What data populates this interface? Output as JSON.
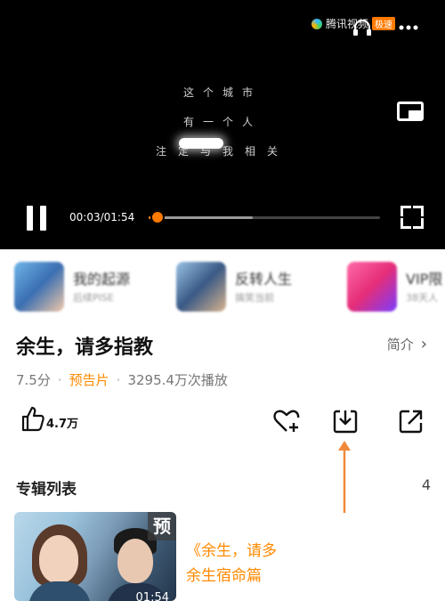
{
  "player": {
    "logo_text": "腾讯视频",
    "logo_tag": "极速",
    "lyrics": [
      "这个城市",
      "有一个人",
      "注定与我相关"
    ],
    "time": "00:03/01:54",
    "progress": 0.04,
    "buffered": 0.45,
    "accent_color": "#ff7a00",
    "icons": [
      "headphones-icon",
      "more-icon",
      "pip-icon",
      "pause-icon",
      "fullscreen-icon"
    ]
  },
  "recommendations": [
    {
      "title": "我的起源",
      "subtitle": "后续PISE"
    },
    {
      "title": "反转人生",
      "subtitle": "搞笑当前"
    },
    {
      "title": "VIP限",
      "subtitle": "38天人"
    }
  ],
  "show": {
    "title": "余生，请多指教",
    "intro_label": "简介",
    "score": "7.5分",
    "type": "预告片",
    "plays": "3295.4万次播放"
  },
  "actions": {
    "like_count": "4.7万",
    "icons": [
      "thumbs-up-icon",
      "favorite-add-icon",
      "download-icon",
      "share-icon"
    ]
  },
  "episodes": {
    "section_title": "专辑列表",
    "count": "4",
    "items": [
      {
        "badge": "预",
        "duration": "01:54",
        "title_line1": "《余生，请多",
        "title_line2": "余生宿命篇"
      }
    ]
  }
}
